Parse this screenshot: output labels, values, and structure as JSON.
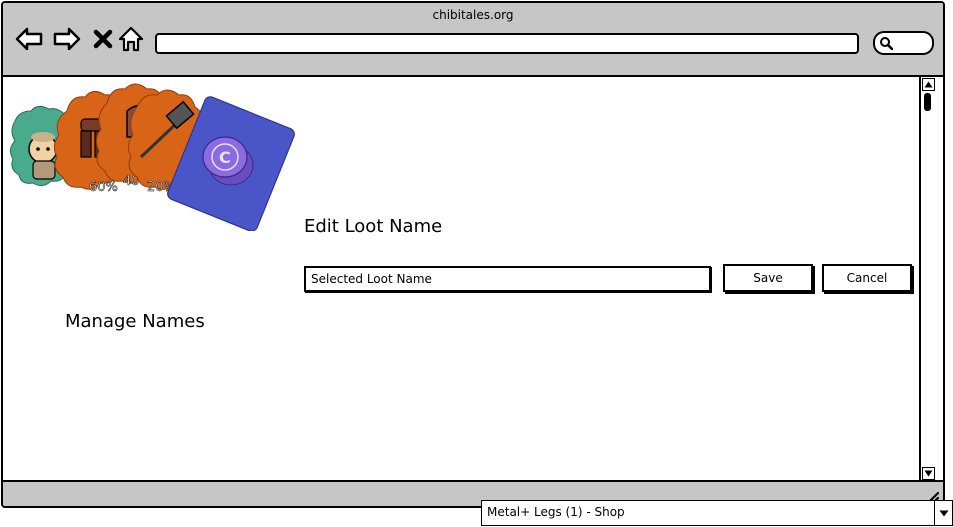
{
  "browser": {
    "site_title": "chibitales.org",
    "address_value": "",
    "search_value": ""
  },
  "logo": {
    "badges": [
      "60%",
      "40%",
      "20%"
    ]
  },
  "sidebar": {
    "manage_names_label": "Manage Names"
  },
  "editor": {
    "title": "Edit Loot Name",
    "name_input_value": "Selected Loot Name",
    "save_label": "Save",
    "cancel_label": "Cancel"
  },
  "bottom_select": {
    "selected_value": "Metal+ Legs (1) - Shop"
  },
  "colors": {
    "chrome_gray": "#c6c6c6",
    "teal": "#4aaa8c",
    "orange": "#d86418",
    "card_blue": "#4a56c8",
    "coin_purple": "#7b5ad6"
  }
}
